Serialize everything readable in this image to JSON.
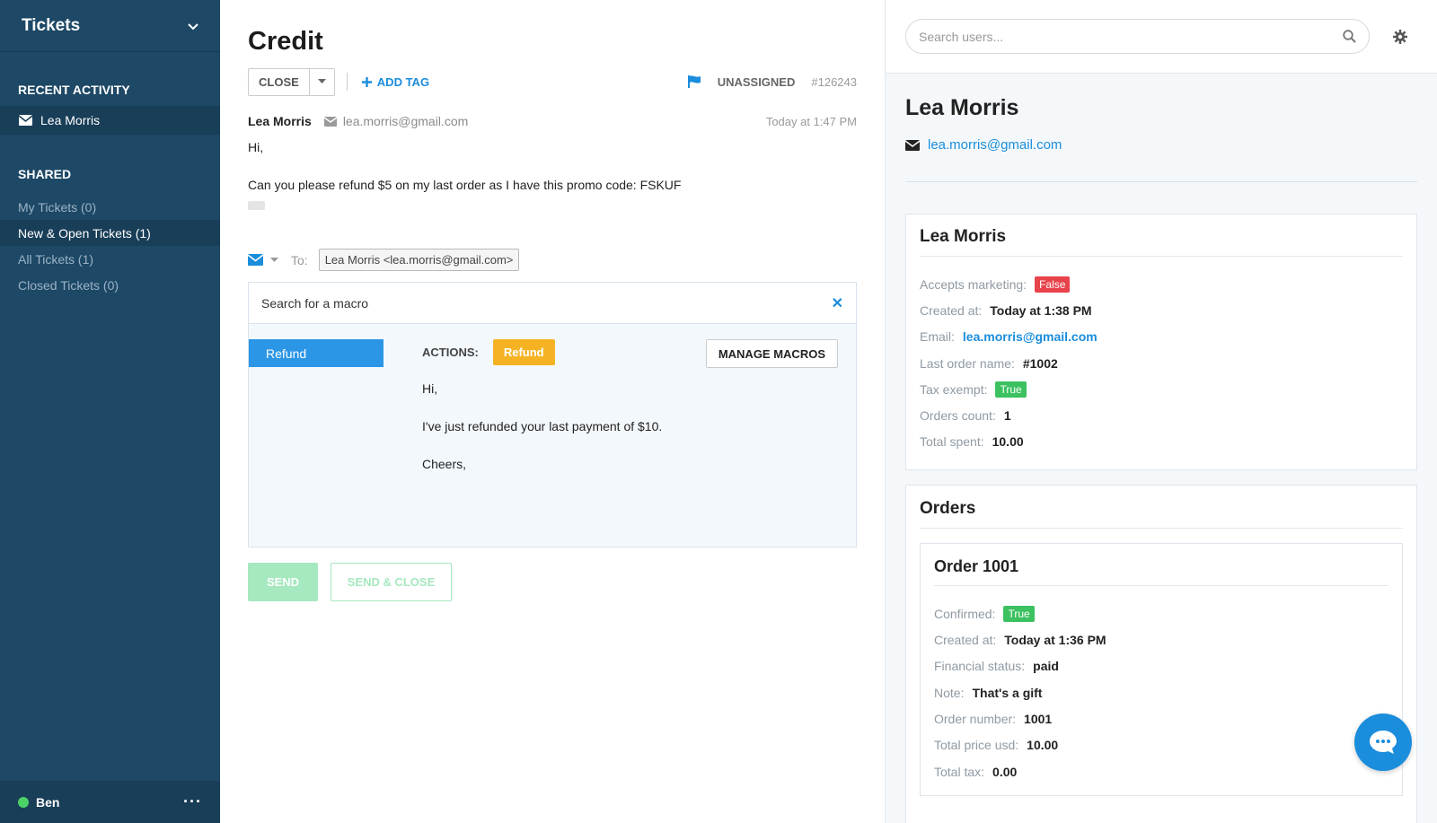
{
  "sidebar": {
    "title": "Tickets",
    "recent_heading": "Recent Activity",
    "recent_item": "Lea Morris",
    "shared_heading": "Shared",
    "items": [
      {
        "label": "My Tickets (0)"
      },
      {
        "label": "New & Open Tickets (1)"
      },
      {
        "label": "All Tickets (1)"
      },
      {
        "label": "Closed Tickets (0)"
      }
    ],
    "active_index": 1,
    "user": "Ben",
    "more": "···",
    "status_color": "#4cd068"
  },
  "ticket": {
    "title": "Credit",
    "close_label": "Close",
    "add_tag_label": "Add Tag",
    "assignee": "Unassigned",
    "id": "#126243",
    "message": {
      "author": "Lea Morris",
      "email": "lea.morris@gmail.com",
      "time": "Today at 1:47 PM",
      "lines": [
        "Hi,",
        "Can you please refund $5 on my last order as I have this promo code: FSKUF"
      ]
    },
    "reply": {
      "to_label": "To:",
      "to_value": "Lea Morris <lea.morris@gmail.com>"
    },
    "macro": {
      "search_text": "Search for a macro",
      "selected": "Refund",
      "actions_label": "Actions:",
      "action_badge": "Refund",
      "manage_label": "Manage Macros",
      "body": [
        "Hi,",
        "I've just refunded your last payment of $10.",
        "Cheers,"
      ]
    },
    "send_label": "Send",
    "send_close_label": "Send & Close"
  },
  "right": {
    "search_placeholder": "Search users...",
    "user_name": "Lea Morris",
    "user_email": "lea.morris@gmail.com",
    "customer_card": {
      "title": "Lea Morris",
      "accepts_marketing_label": "Accepts marketing:",
      "accepts_marketing": "False",
      "created_label": "Created at:",
      "created": "Today at 1:38 PM",
      "email_label": "Email:",
      "email": "lea.morris@gmail.com",
      "last_order_label": "Last order name:",
      "last_order": "#1002",
      "tax_exempt_label": "Tax exempt:",
      "tax_exempt": "True",
      "orders_count_label": "Orders count:",
      "orders_count": "1",
      "total_spent_label": "Total spent:",
      "total_spent": "10.00"
    },
    "orders_card": {
      "title": "Orders",
      "order": {
        "title": "Order 1001",
        "confirmed_label": "Confirmed:",
        "confirmed": "True",
        "created_label": "Created at:",
        "created": "Today at 1:36 PM",
        "financial_label": "Financial status:",
        "financial": "paid",
        "note_label": "Note:",
        "note": "That's a gift",
        "number_label": "Order number:",
        "number": "1001",
        "price_label": "Total price usd:",
        "price": "10.00",
        "tax_label": "Total tax:",
        "tax": "0.00"
      }
    }
  },
  "colors": {
    "sidebar_bg": "#1d4866",
    "accent_blue": "#1a8ddc",
    "macro_orange": "#f5b324",
    "false_red": "#e8424b",
    "true_green": "#3cc160",
    "send_green": "#a6e8bf"
  }
}
